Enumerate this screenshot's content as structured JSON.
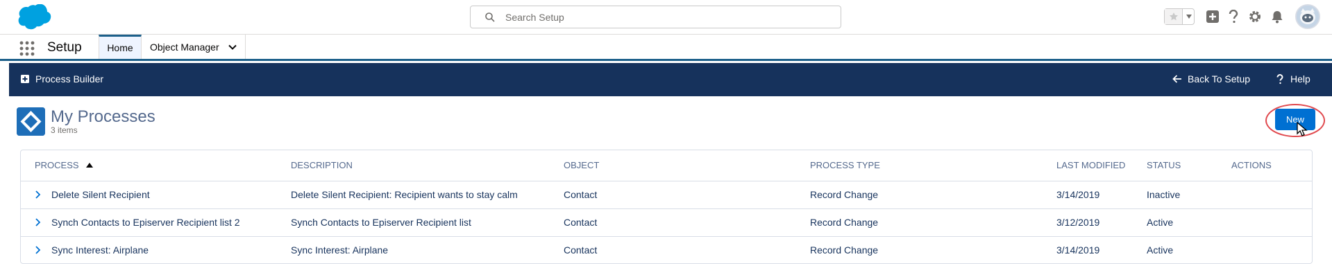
{
  "global_header": {
    "search": {
      "placeholder": "Search Setup",
      "value": ""
    }
  },
  "context_bar": {
    "app_name": "Setup",
    "tabs": [
      {
        "label": "Home",
        "active": true
      },
      {
        "label": "Object Manager",
        "active": false
      }
    ]
  },
  "process_bar": {
    "title": "Process Builder",
    "back_label": "Back To Setup",
    "help_label": "Help"
  },
  "page_header": {
    "title": "My Processes",
    "item_count": "3 items",
    "new_button_label": "New"
  },
  "table": {
    "columns": [
      "PROCESS",
      "DESCRIPTION",
      "OBJECT",
      "PROCESS TYPE",
      "LAST MODIFIED",
      "STATUS",
      "ACTIONS"
    ],
    "rows": [
      {
        "process": "Delete Silent Recipient",
        "description": "Delete Silent Recipient: Recipient wants to stay calm",
        "object": "Contact",
        "process_type": "Record Change",
        "last_modified": "3/14/2019",
        "status": "Inactive",
        "actions": ""
      },
      {
        "process": "Synch Contacts to Episerver Recipient list 2",
        "description": "Synch Contacts to Episerver Recipient list",
        "object": "Contact",
        "process_type": "Record Change",
        "last_modified": "3/12/2019",
        "status": "Active",
        "actions": ""
      },
      {
        "process": "Sync Interest: Airplane",
        "description": "Sync Interest: Airplane",
        "object": "Contact",
        "process_type": "Record Change",
        "last_modified": "3/14/2019",
        "status": "Active",
        "actions": ""
      }
    ]
  },
  "colors": {
    "brand_blue": "#0070d2",
    "process_bar_navy": "#16325c",
    "highlight_red": "#e0474c",
    "cloud_blue": "#00a1e0"
  },
  "icons": [
    "salesforce-logo",
    "search-icon",
    "star-icon",
    "add-icon",
    "help-icon",
    "gear-icon",
    "bell-icon",
    "app-launcher-icon",
    "chevron-down-icon",
    "plus-square-icon",
    "arrow-left-icon",
    "question-icon",
    "process-icon",
    "chevron-right-icon",
    "sort-up-icon",
    "cursor-icon"
  ]
}
